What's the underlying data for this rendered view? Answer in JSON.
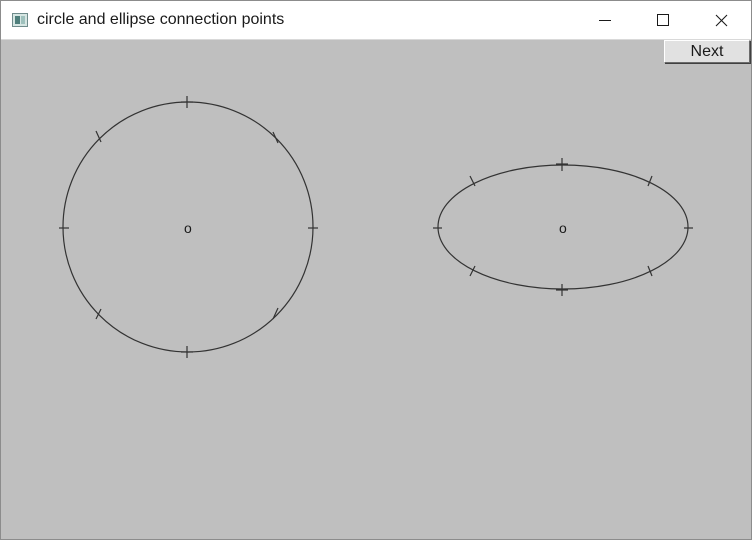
{
  "window": {
    "title": "circle and ellipse connection points",
    "controls": [
      "minimize",
      "maximize",
      "close"
    ]
  },
  "toolbar": {
    "next_label": "Next"
  },
  "canvas": {
    "background": "#bfbfbf",
    "shapes": [
      {
        "kind": "circle",
        "center_label": "o",
        "connection_points": 8
      },
      {
        "kind": "ellipse",
        "center_label": "o",
        "connection_points": 8
      }
    ]
  }
}
